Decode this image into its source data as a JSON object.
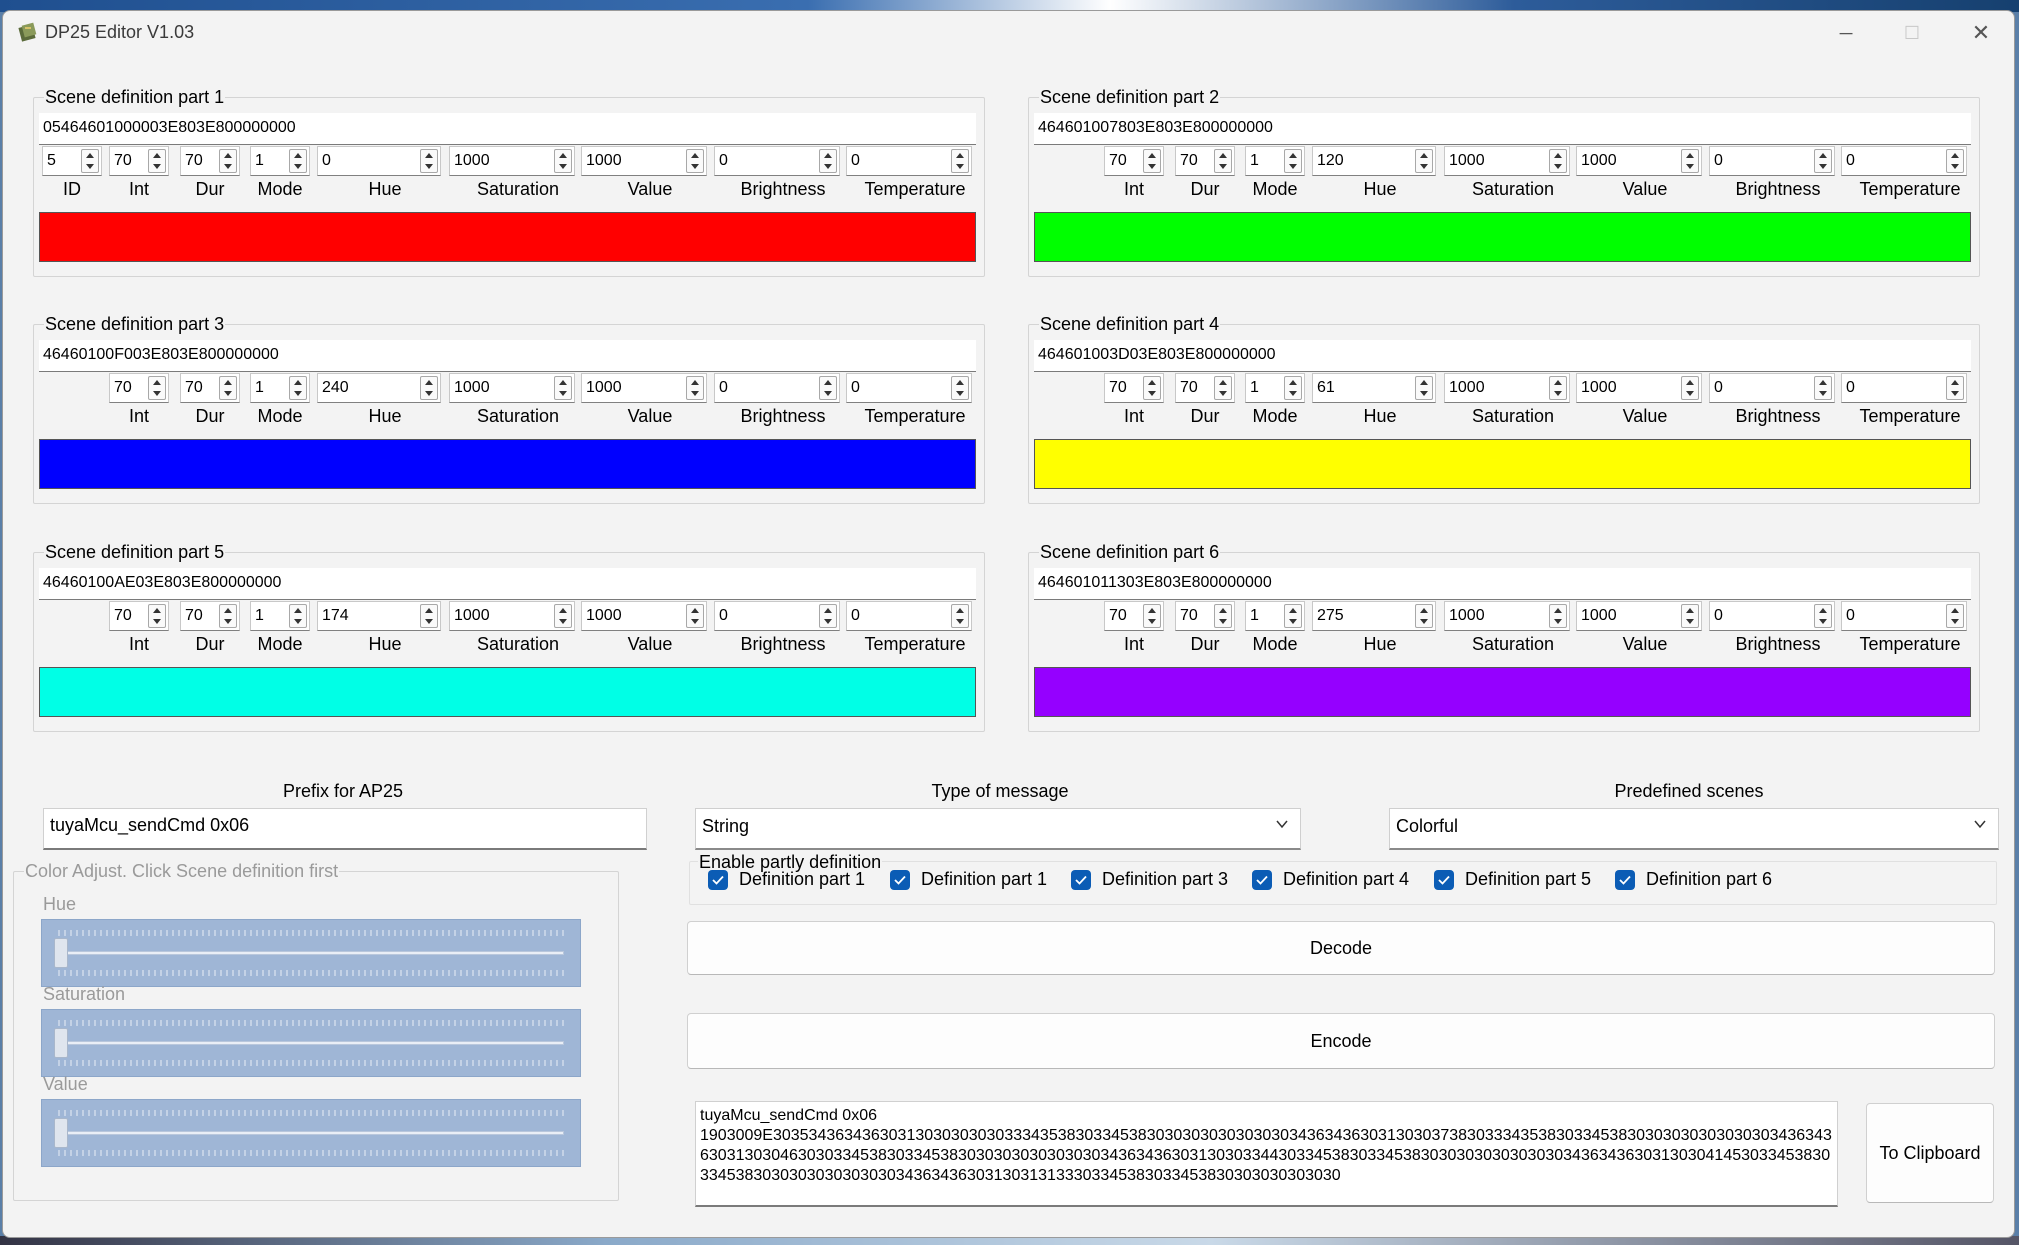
{
  "window": {
    "title": "DP25 Editor V1.03",
    "minimize": "─",
    "maximize": "☐",
    "close": "✕"
  },
  "scenes": [
    {
      "label": "Scene definition part 1",
      "hex": "05464601000003E803E800000000",
      "id": "5",
      "int": "70",
      "dur": "70",
      "mode": "1",
      "hue": "0",
      "saturation": "1000",
      "value": "1000",
      "brightness": "0",
      "temperature": "0",
      "color": "#ff0000",
      "show_id": true
    },
    {
      "label": "Scene definition part 2",
      "hex": "464601007803E803E800000000",
      "int": "70",
      "dur": "70",
      "mode": "1",
      "hue": "120",
      "saturation": "1000",
      "value": "1000",
      "brightness": "0",
      "temperature": "0",
      "color": "#00ff00",
      "show_id": false
    },
    {
      "label": "Scene definition part 3",
      "hex": "46460100F003E803E800000000",
      "int": "70",
      "dur": "70",
      "mode": "1",
      "hue": "240",
      "saturation": "1000",
      "value": "1000",
      "brightness": "0",
      "temperature": "0",
      "color": "#0000ff",
      "show_id": false
    },
    {
      "label": "Scene definition part 4",
      "hex": "464601003D03E803E800000000",
      "int": "70",
      "dur": "70",
      "mode": "1",
      "hue": "61",
      "saturation": "1000",
      "value": "1000",
      "brightness": "0",
      "temperature": "0",
      "color": "#ffff00",
      "show_id": false
    },
    {
      "label": "Scene definition part 5",
      "hex": "46460100AE03E803E800000000",
      "int": "70",
      "dur": "70",
      "mode": "1",
      "hue": "174",
      "saturation": "1000",
      "value": "1000",
      "brightness": "0",
      "temperature": "0",
      "color": "#00ffe6",
      "show_id": false
    },
    {
      "label": "Scene definition part 6",
      "hex": "464601011303E803E800000000",
      "int": "70",
      "dur": "70",
      "mode": "1",
      "hue": "275",
      "saturation": "1000",
      "value": "1000",
      "brightness": "0",
      "temperature": "0",
      "color": "#9500ff",
      "show_id": false
    }
  ],
  "field_labels": {
    "id": "ID",
    "int": "Int",
    "dur": "Dur",
    "mode": "Mode",
    "hue": "Hue",
    "saturation": "Saturation",
    "value": "Value",
    "brightness": "Brightness",
    "temperature": "Temperature"
  },
  "prefix": {
    "label": "Prefix for AP25",
    "value": "tuyaMcu_sendCmd 0x06"
  },
  "message_type": {
    "label": "Type of message",
    "value": "String"
  },
  "predefined": {
    "label": "Predefined scenes",
    "value": "Colorful"
  },
  "partly": {
    "label": "Enable partly definition",
    "items": [
      "Definition part 1",
      "Definition part 1",
      "Definition part 3",
      "Definition part 4",
      "Definition part 5",
      "Definition part 6"
    ]
  },
  "color_adjust": {
    "label": "Color Adjust. Click Scene definition first",
    "hue": "Hue",
    "saturation": "Saturation",
    "value": "Value"
  },
  "buttons": {
    "decode": "Decode",
    "encode": "Encode",
    "clipboard": "To Clipboard"
  },
  "output": {
    "line1": "tuyaMcu_sendCmd 0x06",
    "line2": "1903009E303534363436303130303030303334353830334538303030303030303034363436303130303738303334353830334538303030303030303034363436303130304630303345383033453830303030303030303436343630313030334430334538303345383030303030303030343634363031303041453033453830334538303030303030303034363436303130313133303345383033453830303030303030"
  }
}
